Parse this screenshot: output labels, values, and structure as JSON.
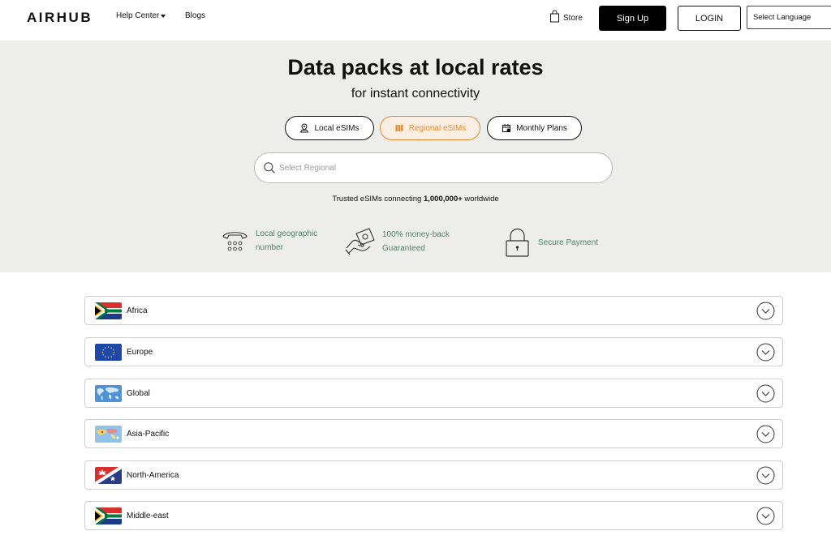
{
  "header": {
    "logo": "AIRHUB",
    "help_center": "Help Center",
    "blogs": "Blogs",
    "store": "Store",
    "sign_up": "Sign Up",
    "login": "LOGIN",
    "language": "Select Language"
  },
  "hero": {
    "title": "Data packs at local rates",
    "subtitle": "for instant connectivity",
    "tabs": [
      {
        "label": "Local eSIMs",
        "icon": "map-pin-icon",
        "active": false
      },
      {
        "label": "Regional eSIMs",
        "icon": "map-icon",
        "active": true
      },
      {
        "label": "Monthly Plans",
        "icon": "calendar-icon",
        "active": false
      }
    ],
    "search_placeholder": "Select Regional",
    "trusted_prefix": "Trusted eSIMs connecting ",
    "trusted_count": "1,000,000+",
    "trusted_suffix": " worldwide",
    "features": [
      {
        "line1": "Local geographic",
        "line2": "number",
        "icon": "telephone-icon"
      },
      {
        "line1": "100% money-back",
        "line2": "Guaranteed",
        "icon": "money-hand-icon"
      },
      {
        "line1": "Secure Payment",
        "line2": "",
        "icon": "padlock-icon"
      }
    ]
  },
  "regions": [
    {
      "label": "Africa",
      "icon": "south-africa-flag-icon"
    },
    {
      "label": "Europe",
      "icon": "eu-flag-icon"
    },
    {
      "label": "Global",
      "icon": "world-map-flag-icon"
    },
    {
      "label": "Asia-Pacific",
      "icon": "asia-pacific-flag-icon"
    },
    {
      "label": "North-America",
      "icon": "north-america-flag-icon"
    },
    {
      "label": "Middle-east",
      "icon": "south-africa-flag-icon"
    }
  ],
  "colors": {
    "accent": "#e6882f",
    "accent_bg": "#fbeee2",
    "hero_bg": "#ededeb",
    "feature_text": "#4f8468"
  }
}
